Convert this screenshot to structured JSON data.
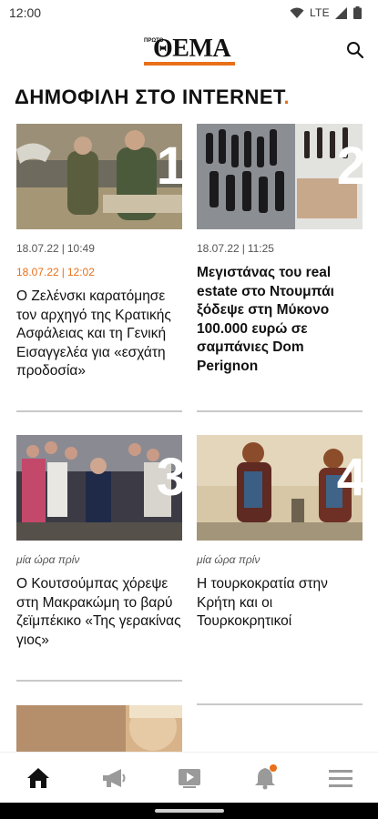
{
  "status_bar": {
    "time": "12:00",
    "network": "LTE"
  },
  "header": {
    "logo_prefix": "ΠΡΩΤΟ",
    "logo_text": "ΘΕΜΑ"
  },
  "section": {
    "title": "ΔΗΜΟΦΙΛΗ ΣΤΟ INTERNET",
    "title_accent": "."
  },
  "articles": [
    {
      "rank": "1",
      "date": "18.07.22",
      "time": "10:49",
      "highlight_date": "18.07.22",
      "highlight_time": "12:02",
      "headline": "Ο Ζελένσκι καρατόμησε  τον αρχηγό της  Κρατικής Ασφάλειας και τη Γενική Εισαγγελέα για «εσχάτη προδοσία»"
    },
    {
      "rank": "2",
      "date": "18.07.22",
      "time": "11:25",
      "headline": "Μεγιστάνας του real estate στο Ντουμπάι ξόδεψε στη Μύκονο 100.000 ευρώ σε σαμπάνιες Dom Perignon"
    },
    {
      "rank": "3",
      "ago": "μία ώρα πρίν",
      "headline": "Ο Κουτσούμπας χόρεψε στη Μακρακώμη το βαρύ ζεϊμπέκικο «Της γερακίνας γιος»"
    },
    {
      "rank": "4",
      "ago": "μία ώρα πρίν",
      "headline": "Η τουρκοκρατία στην Κρήτη και οι Τουρκοκρητικοί"
    }
  ],
  "nav": {
    "items": [
      {
        "name": "home",
        "icon": "home-icon",
        "active": true
      },
      {
        "name": "announcements",
        "icon": "megaphone-icon"
      },
      {
        "name": "video",
        "icon": "video-icon"
      },
      {
        "name": "notifications",
        "icon": "bell-icon",
        "badge": true
      },
      {
        "name": "menu",
        "icon": "menu-icon"
      }
    ]
  },
  "colors": {
    "accent": "#e8701a",
    "text": "#111111",
    "muted": "#555555",
    "divider": "#c9c9c9",
    "nav_inactive": "#9a9a9a"
  }
}
